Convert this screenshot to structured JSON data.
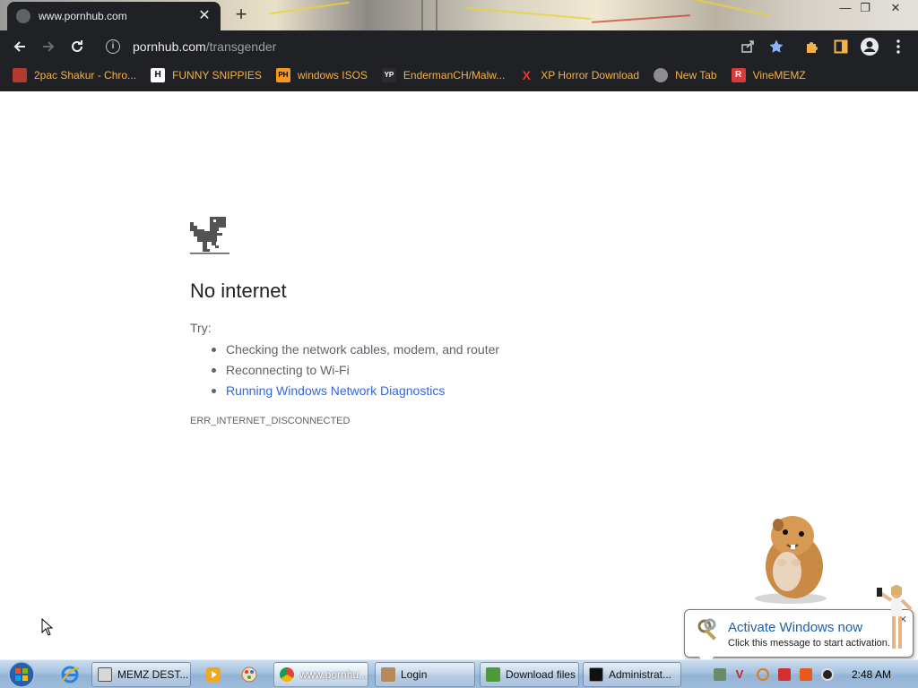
{
  "browser": {
    "tab_title": "www.pornhub.com",
    "tab_close": "✕",
    "new_tab": "+",
    "window_controls": {
      "minimize": "—",
      "restore": "❐",
      "close": "✕"
    },
    "url_host": "pornhub.com",
    "url_path": "/transgender",
    "info_glyph": "i"
  },
  "bookmarks": [
    {
      "label": "2pac Shakur - Chro...",
      "icon": "tupac-icon",
      "icon_text": "",
      "icon_color": "#b33b2e"
    },
    {
      "label": "FUNNY SNIPPIES",
      "icon": "h-letter-icon",
      "icon_text": "H",
      "icon_color": "#ffffff"
    },
    {
      "label": "windows ISOS",
      "icon": "ph-icon",
      "icon_text": "PH",
      "icon_color": "#f7971d"
    },
    {
      "label": "EndermanCH/Malw...",
      "icon": "yp-icon",
      "icon_text": "YP",
      "icon_color": "#2b2b2b"
    },
    {
      "label": "XP Horror Download",
      "icon": "x-icon",
      "icon_text": "X",
      "icon_color": "#e03a2e"
    },
    {
      "label": "New Tab",
      "icon": "globe-icon",
      "icon_text": "",
      "icon_color": "#8e8e8e"
    },
    {
      "label": "VineMEMZ",
      "icon": "r-icon",
      "icon_text": "R",
      "icon_color": "#d93a3a"
    }
  ],
  "page": {
    "title": "No internet",
    "try_label": "Try:",
    "suggestions": [
      "Checking the network cables, modem, and router",
      "Reconnecting to Wi-Fi",
      "Running Windows Network Diagnostics"
    ],
    "error_code": "ERR_INTERNET_DISCONNECTED"
  },
  "activation": {
    "title": "Activate Windows now",
    "text": "Click this message to start activation.",
    "close": "✕"
  },
  "taskbar": {
    "tasks": [
      {
        "label": "MEMZ DEST...",
        "icon": "memz-icon"
      },
      {
        "label": "www.pornhu...",
        "icon": "chrome-icon"
      },
      {
        "label": "Login",
        "icon": "login-icon"
      },
      {
        "label": "Download files",
        "icon": "download-icon"
      },
      {
        "label": "Administrat...",
        "icon": "cmd-icon"
      }
    ],
    "clock": "2:48 AM"
  },
  "colors": {
    "chrome_dark": "#202124",
    "bookmark_text": "#f5b247",
    "link": "#3367d6",
    "activation_title": "#1c5fa8"
  }
}
